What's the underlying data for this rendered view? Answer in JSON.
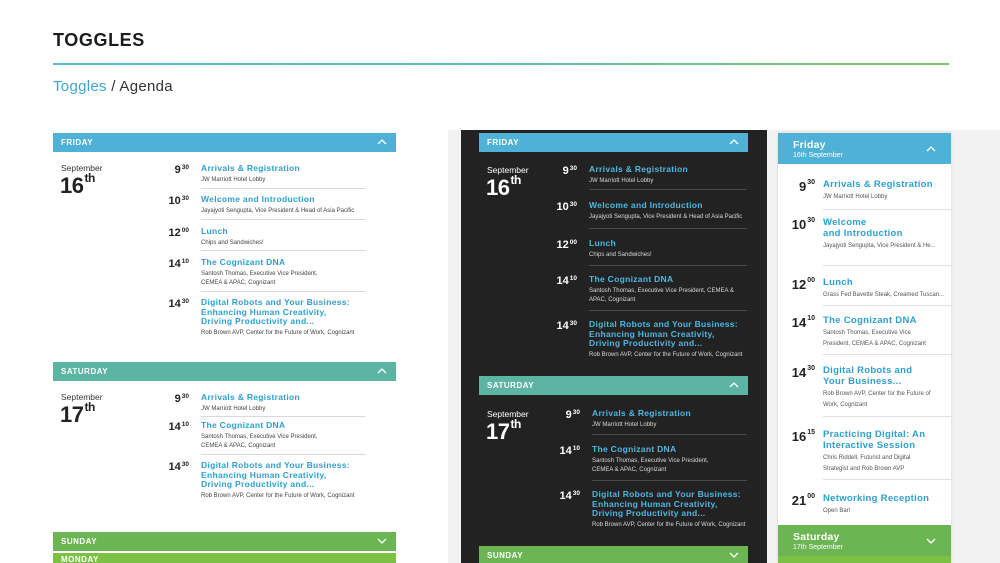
{
  "header": {
    "title": "TOGGLES",
    "breadcrumb_link": "Toggles",
    "breadcrumb_sep": " / ",
    "breadcrumb_current": "Agenda"
  },
  "colors": {
    "blue": "#4fb1d6",
    "teal": "#5bb5a2",
    "green": "#6cb553",
    "dark_bg": "#222222",
    "link": "#2e9fcf"
  },
  "light": {
    "friday": {
      "label": "FRIDAY",
      "month": "September",
      "day": "16",
      "suffix": "th",
      "items": [
        {
          "h": "9",
          "m": "30",
          "title": "Arrivals & Registration",
          "sub": "JW Marriott Hotel Lobby"
        },
        {
          "h": "10",
          "m": "30",
          "title": "Welcome and Introduction",
          "sub": "Jayajyoti Sengupta, Vice President & Head of Asia Pacific"
        },
        {
          "h": "12",
          "m": "00",
          "title": "Lunch",
          "sub": "Chips and Sandwiches!"
        },
        {
          "h": "14",
          "m": "10",
          "title": "The Cognizant DNA",
          "sub": "Santosh Thomas, Executive Vice President,\nCEMEA & APAC, Cognizant"
        },
        {
          "h": "14",
          "m": "30",
          "title": "Digital Robots and Your Business:\nEnhancing Human Creativity,\nDriving Productivity and...",
          "sub": "Rob Brown AVP, Center for the Future of Work, Cognizant"
        }
      ]
    },
    "saturday": {
      "label": "SATURDAY",
      "month": "September",
      "day": "17",
      "suffix": "th",
      "items": [
        {
          "h": "9",
          "m": "30",
          "title": "Arrivals & Registration",
          "sub": "JW Marriott Hotel Lobby"
        },
        {
          "h": "14",
          "m": "10",
          "title": "The Cognizant DNA",
          "sub": "Santosh Thomas, Executive Vice President,\nCEMEA & APAC, Cognizant"
        },
        {
          "h": "14",
          "m": "30",
          "title": "Digital Robots and Your Business:\nEnhancing Human Creativity,\nDriving Productivity and...",
          "sub": "Rob Brown AVP, Center for the Future of Work, Cognizant"
        }
      ]
    },
    "sunday": {
      "label": "SUNDAY"
    },
    "monday": {
      "label": "MONDAY"
    }
  },
  "dark": {
    "friday": {
      "label": "FRIDAY",
      "month": "September",
      "day": "16",
      "suffix": "th",
      "items": [
        {
          "h": "9",
          "m": "30",
          "title": "Arrivals & Registration",
          "sub": "JW Marriott Hotel Lobby"
        },
        {
          "h": "10",
          "m": "30",
          "title": "Welcome and Introduction",
          "sub": "Jayajyoti Sengupta, Vice President & Head of Asia Pacific"
        },
        {
          "h": "12",
          "m": "00",
          "title": "Lunch",
          "sub": "Chips and Sandwiches!"
        },
        {
          "h": "14",
          "m": "10",
          "title": "The Cognizant DNA",
          "sub": "Santosh Thomas, Executive Vice President, CEMEA &\nAPAC, Cognizant"
        },
        {
          "h": "14",
          "m": "30",
          "title": "Digital Robots and Your Business:\nEnhancing Human Creativity,\nDriving Productivity and...",
          "sub": "Rob Brown AVP, Center for the Future of Work, Cognizant"
        }
      ]
    },
    "saturday": {
      "label": "SATURDAY",
      "month": "September",
      "day": "17",
      "suffix": "th",
      "items": [
        {
          "h": "9",
          "m": "30",
          "title": "Arrivals & Registration",
          "sub": "JW Marriott Hotel Lobby"
        },
        {
          "h": "14",
          "m": "10",
          "title": "The Cognizant DNA",
          "sub": "Santosh Thomas, Executive Vice President,\nCEMEA & APAC, Cognizant"
        },
        {
          "h": "14",
          "m": "30",
          "title": "Digital Robots and Your Business:\nEnhancing Human Creativity,\nDriving Productivity and...",
          "sub": "Rob Brown AVP, Center for the Future of Work, Cognizant"
        }
      ]
    },
    "sunday": {
      "label": "SUNDAY"
    }
  },
  "mobile": {
    "friday": {
      "day_name": "Friday",
      "date": "16th September"
    },
    "items": [
      {
        "h": "9",
        "m": "30",
        "title": "Arrivals & Registration",
        "sub": "JW Marriott Hotel Lobby"
      },
      {
        "h": "10",
        "m": "30",
        "title": "Welcome\nand Introduction",
        "sub": "Jayajyoti Sengupta, Vice President & He..."
      },
      {
        "h": "12",
        "m": "00",
        "title": "Lunch",
        "sub": "Grass Fed Bavette Steak, Creamed Tuscan..."
      },
      {
        "h": "14",
        "m": "10",
        "title": "The Cognizant DNA",
        "sub": "Santosh Thomas, Executive Vice\nPresident, CEMEA & APAC, Cognizant"
      },
      {
        "h": "14",
        "m": "30",
        "title": "Digital Robots and\nYour Business...",
        "sub": "Rob Brown AVP, Center for the Future of\nWork, Cognizant"
      },
      {
        "h": "16",
        "m": "15",
        "title": "Practicing Digital: An\nInteractive Session",
        "sub": "Chris Riddell, Futurist and Digital\nStrategist and Rob Brown AVP"
      },
      {
        "h": "21",
        "m": "00",
        "title": "Networking Reception",
        "sub": "Open Bar!"
      }
    ],
    "saturday": {
      "day_name": "Saturday",
      "date": "17th September"
    }
  }
}
